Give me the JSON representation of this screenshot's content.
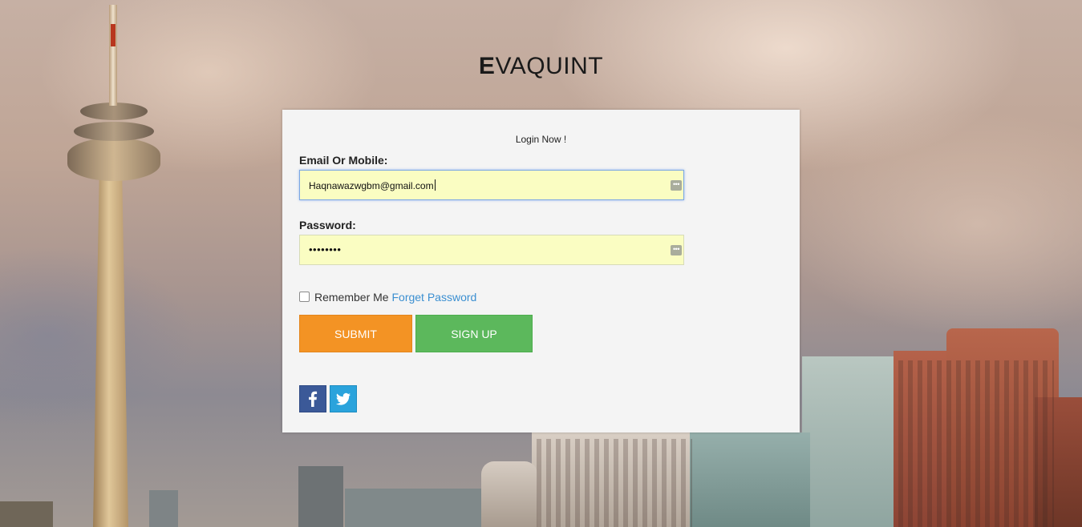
{
  "brand": {
    "first_letter": "E",
    "rest": "VAQUINT"
  },
  "login": {
    "heading": "Login Now !",
    "email_label": "Email Or Mobile:",
    "email_value": "Haqnawazwgbm@gmail.com",
    "password_label": "Password:",
    "password_masked": "••••••••",
    "remember_label": "Remember Me",
    "forget_label": "Forget Password",
    "submit_label": "SUBMIT",
    "signup_label": "SIGN UP",
    "key_icon_glyph": "•••"
  },
  "social": {
    "facebook_icon": "facebook-icon",
    "twitter_icon": "twitter-icon"
  },
  "colors": {
    "submit": "#f39324",
    "signup": "#5cb85c",
    "link": "#3b8fd1",
    "facebook": "#3b5998",
    "twitter": "#2aa3dc",
    "autofill": "#fafdc2"
  }
}
